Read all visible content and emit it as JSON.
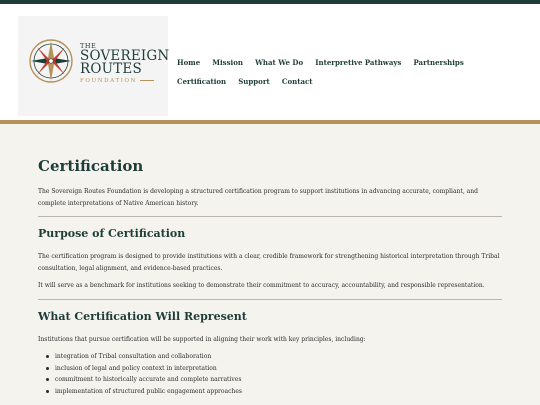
{
  "logo": {
    "the": "THE",
    "line1": "SOVEREIGN",
    "line2": "ROUTES",
    "foundation": "FOUNDATION"
  },
  "nav": {
    "items": [
      "Home",
      "Mission",
      "What We Do",
      "Interpretive Pathways",
      "Partnerships",
      "Certification",
      "Support",
      "Contact"
    ]
  },
  "page": {
    "title": "Certification",
    "intro": "The Sovereign Routes Foundation is developing a structured certification program to support institutions in advancing accurate, compliant, and complete interpretations of Native American history."
  },
  "sections": [
    {
      "title": "Purpose of Certification",
      "paragraphs": [
        "The certification program is designed to provide institutions with a clear, credible framework for strengthening historical interpretation through Tribal consultation, legal alignment, and evidence-based practices.",
        "It will serve as a benchmark for institutions seeking to demonstrate their commitment to accuracy, accountability, and responsible representation."
      ]
    },
    {
      "title": "What Certification Will Represent",
      "paragraphs": [
        "Institutions that pursue certification will be supported in aligning their work with key principles, including:"
      ],
      "bullets": [
        "integration of Tribal consultation and collaboration",
        "inclusion of legal and policy context in interpretation",
        "commitment to historically accurate and complete narratives",
        "implementation of structured public engagement approaches"
      ]
    }
  ],
  "colors": {
    "brand_green": "#1f3d38",
    "accent_gold": "#b5925a",
    "page_bg": "#f5f3ee"
  },
  "icons": {
    "logo": "compass-rose-icon"
  }
}
